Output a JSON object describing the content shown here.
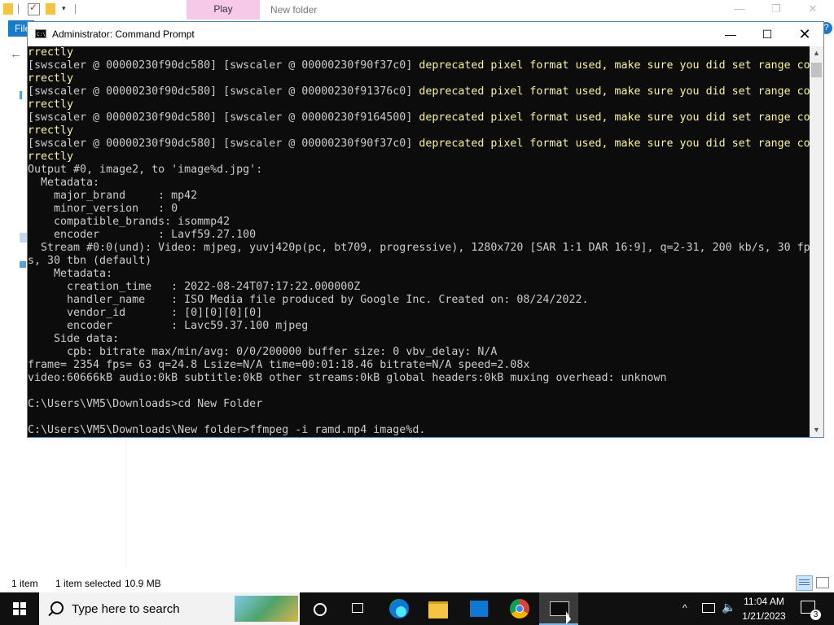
{
  "explorer": {
    "ribbon_tab_play": "Play",
    "title": "New folder",
    "file_tab": "File",
    "help": "?",
    "status": {
      "count": "1 item",
      "selected": "1 item selected",
      "size": "10.9 MB"
    }
  },
  "cmd": {
    "title": "Administrator:  Command Prompt",
    "lines": [
      {
        "text": "rrectly",
        "style": "warn"
      },
      {
        "text": "[swscaler @ 00000230f90dc580] [swscaler @ 00000230f90f37c0] deprecated pixel format used, make sure you did set range co",
        "style": "mixed"
      },
      {
        "text": "rrectly",
        "style": "warn"
      },
      {
        "text": "[swscaler @ 00000230f90dc580] [swscaler @ 00000230f91376c0] deprecated pixel format used, make sure you did set range co",
        "style": "mixed"
      },
      {
        "text": "rrectly",
        "style": "warn"
      },
      {
        "text": "[swscaler @ 00000230f90dc580] [swscaler @ 00000230f9164500] deprecated pixel format used, make sure you did set range co",
        "style": "mixed"
      },
      {
        "text": "rrectly",
        "style": "warn"
      },
      {
        "text": "[swscaler @ 00000230f90dc580] [swscaler @ 00000230f90f37c0] deprecated pixel format used, make sure you did set range co",
        "style": "mixed"
      },
      {
        "text": "rrectly",
        "style": "warn"
      },
      {
        "text": "Output #0, image2, to 'image%d.jpg':",
        "style": "normal"
      },
      {
        "text": "  Metadata:",
        "style": "normal"
      },
      {
        "text": "    major_brand     : mp42",
        "style": "normal"
      },
      {
        "text": "    minor_version   : 0",
        "style": "normal"
      },
      {
        "text": "    compatible_brands: isommp42",
        "style": "normal"
      },
      {
        "text": "    encoder         : Lavf59.27.100",
        "style": "normal"
      },
      {
        "text": "  Stream #0:0(und): Video: mjpeg, yuvj420p(pc, bt709, progressive), 1280x720 [SAR 1:1 DAR 16:9], q=2-31, 200 kb/s, 30 fp",
        "style": "normal"
      },
      {
        "text": "s, 30 tbn (default)",
        "style": "normal"
      },
      {
        "text": "    Metadata:",
        "style": "normal"
      },
      {
        "text": "      creation_time   : 2022-08-24T07:17:22.000000Z",
        "style": "normal"
      },
      {
        "text": "      handler_name    : ISO Media file produced by Google Inc. Created on: 08/24/2022.",
        "style": "normal"
      },
      {
        "text": "      vendor_id       : [0][0][0][0]",
        "style": "normal"
      },
      {
        "text": "      encoder         : Lavc59.37.100 mjpeg",
        "style": "normal"
      },
      {
        "text": "    Side data:",
        "style": "normal"
      },
      {
        "text": "      cpb: bitrate max/min/avg: 0/0/200000 buffer size: 0 vbv_delay: N/A",
        "style": "normal"
      },
      {
        "text": "frame= 2354 fps= 63 q=24.8 Lsize=N/A time=00:01:18.46 bitrate=N/A speed=2.08x",
        "style": "normal"
      },
      {
        "text": "video:60666kB audio:0kB subtitle:0kB other streams:0kB global headers:0kB muxing overhead: unknown",
        "style": "normal"
      },
      {
        "text": "",
        "style": "normal"
      },
      {
        "text": "C:\\Users\\VM5\\Downloads>cd New Folder",
        "style": "normal"
      },
      {
        "text": "",
        "style": "normal"
      },
      {
        "text": "C:\\Users\\VM5\\Downloads\\New folder>ffmpeg -i ramd.mp4 image%d.",
        "style": "normal"
      }
    ],
    "colors": {
      "background": "#0c0c0c",
      "text": "#cccccc",
      "warning": "#f9f1a5"
    }
  },
  "taskbar": {
    "search_placeholder": "Type here to search",
    "pinned": [
      "cortana-icon",
      "task-view-icon",
      "edge-icon",
      "file-explorer-icon",
      "store-icon",
      "chrome-icon",
      "command-prompt-icon"
    ],
    "clock_time": "11:04 AM",
    "clock_date": "1/21/2023",
    "notification_count": "3"
  }
}
